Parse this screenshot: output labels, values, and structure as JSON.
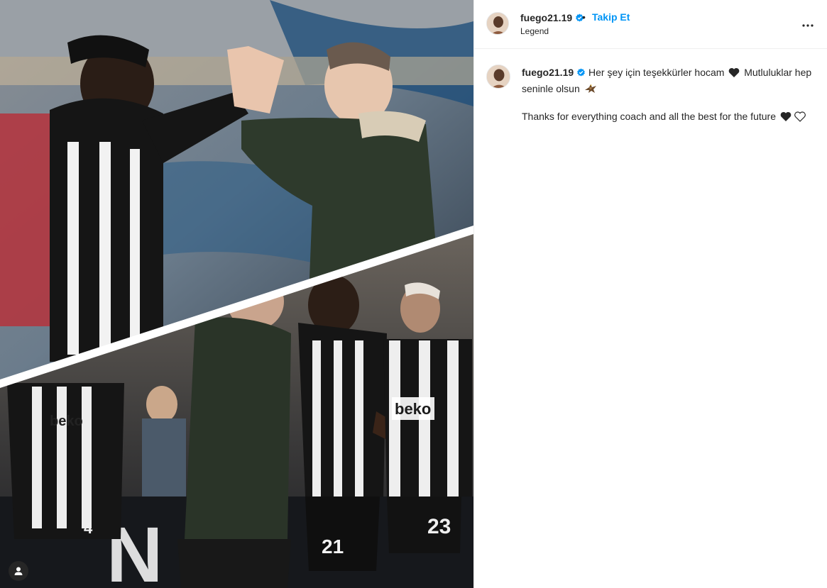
{
  "post": {
    "username": "fuego21.19",
    "follow_label": "Takip Et",
    "separator": "•",
    "location": "Legend"
  },
  "caption": {
    "username": "fuego21.19",
    "text_line1": "Her şey için teşekkürler hocam",
    "text_line1b": "Mutluluklar hep seninle olsun",
    "text_line2": "Thanks for everything coach and all the best for the future"
  },
  "media": {
    "jersey_numbers": [
      "21",
      "23",
      "4"
    ],
    "sponsor_text": "beko"
  },
  "icons": {
    "verified": "verified-badge-icon",
    "more": "more-options-icon",
    "user_tag": "user-tag-icon",
    "heart_black": "black-heart-icon",
    "heart_outline": "white-heart-icon",
    "eagle": "eagle-icon"
  },
  "colors": {
    "accent": "#0095f6",
    "text": "#262626",
    "border": "#efefef"
  }
}
